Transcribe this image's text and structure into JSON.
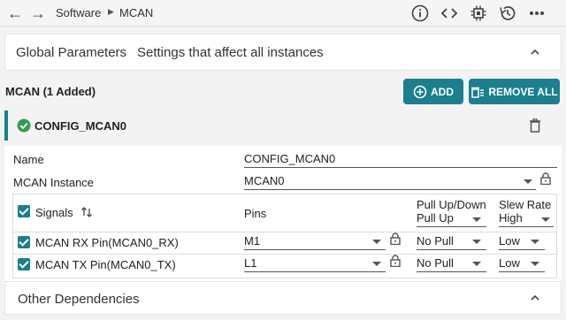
{
  "breadcrumb": {
    "parent": "Software",
    "current": "MCAN"
  },
  "toolbar": {
    "icons": [
      "info-icon",
      "code-icon",
      "chip-icon",
      "history-icon",
      "more-icon"
    ]
  },
  "global_params": {
    "title": "Global Parameters",
    "subtitle": "Settings that affect all instances"
  },
  "module": {
    "label": "MCAN (1 Added)",
    "add_label": "ADD",
    "remove_all_label": "REMOVE ALL"
  },
  "config": {
    "name": "CONFIG_MCAN0",
    "fields": {
      "name_label": "Name",
      "name_value": "CONFIG_MCAN0",
      "instance_label": "MCAN Instance",
      "instance_value": "MCAN0"
    }
  },
  "signals": {
    "header": {
      "signals": "Signals",
      "pins": "Pins",
      "pull_title": "Pull Up/Down",
      "pull_value": "Pull Up",
      "slew_title": "Slew Rate",
      "slew_value": "High"
    },
    "rows": [
      {
        "name": "MCAN RX Pin(MCAN0_RX)",
        "pin": "M1",
        "pull": "No Pull",
        "slew": "Low"
      },
      {
        "name": "MCAN TX Pin(MCAN0_TX)",
        "pin": "L1",
        "pull": "No Pull",
        "slew": "Low"
      }
    ]
  },
  "other": {
    "title": "Other Dependencies"
  },
  "colors": {
    "accent": "#1a7f8e",
    "success": "#2e9e4f"
  }
}
